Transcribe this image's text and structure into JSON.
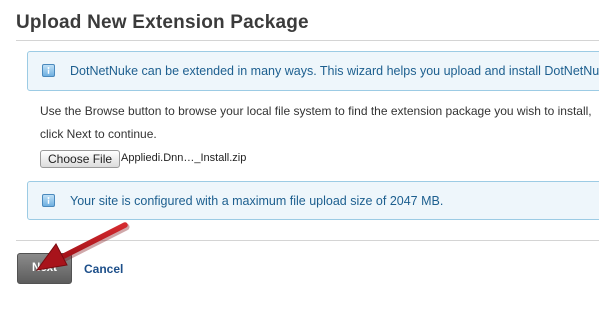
{
  "page": {
    "title": "Upload New Extension Package"
  },
  "info_boxes": [
    {
      "icon": "info-icon",
      "text": "DotNetNuke can be extended in many ways. This wizard helps you upload and install DotNetNuke"
    },
    {
      "icon": "info-icon",
      "text": "Your site is configured with a maximum file upload size of 2047 MB."
    }
  ],
  "instructions": {
    "line1": "Use the Browse button to browse your local file system to find the extension package you wish to install,",
    "line2": "click Next to continue."
  },
  "file_input": {
    "button_label": "Choose File",
    "file_name": "Appliedi.Dnn…_Install.zip"
  },
  "actions": {
    "next_label": "Next",
    "cancel_label": "Cancel"
  },
  "colors": {
    "info_border": "#9ccbe4",
    "info_background": "#eef6fb",
    "info_text": "#1d5f8f",
    "annotation_arrow": "#b0141c",
    "link": "#1d4f8a"
  }
}
